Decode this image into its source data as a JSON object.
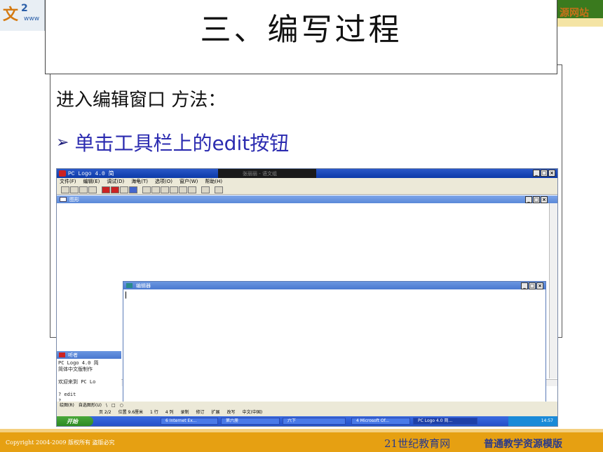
{
  "header": {
    "logo_mark": "文",
    "logo_digit": "2",
    "logo_sub": "www",
    "right_text": "源网站"
  },
  "slide": {
    "title": "三、编写过程",
    "method_text": "进入编辑窗口 方法：",
    "bullet_text": "单击工具栏上的edit按钮"
  },
  "screenshot": {
    "app_title": "PC Logo 4.0 简",
    "title_overlay": "张丽丽 - 语文组",
    "window_buttons": [
      "_",
      "□",
      "×"
    ],
    "menus": [
      "文件(F)",
      "编辑(E)",
      "调试(D)",
      "海龟(T)",
      "选项(O)",
      "窗户(W)",
      "帮助(H)"
    ],
    "graph_window_title": "图形",
    "editor_title": "编辑器",
    "listener_title": "听者",
    "listener_lines": [
      "PC Logo 4.0 简",
      "简体中文版制作",
      "",
      "欢迎来到 PC Lo",
      "",
      "? edit",
      "?"
    ],
    "drawbar": [
      "绘图(R)",
      "自选图形(U)",
      "\\",
      "□",
      "○"
    ],
    "statusbar": [
      "页 2/2",
      "位置 9.6厘米",
      "1 行",
      "4 列",
      "录制",
      "修订",
      "扩展",
      "改写",
      "中文(中国)"
    ],
    "start_label": "开始",
    "tasks": [
      "6 Internet Ex...",
      "第六册",
      "六下",
      "4 Microsoft Of...",
      "PC Logo 4.0 简..."
    ],
    "clock": "14:57"
  },
  "footer": {
    "copyright": "Copyright 2004-2009 版权所有 盗版必究",
    "brand": "21世纪教育网",
    "brand2": "普通教学资源模版"
  }
}
